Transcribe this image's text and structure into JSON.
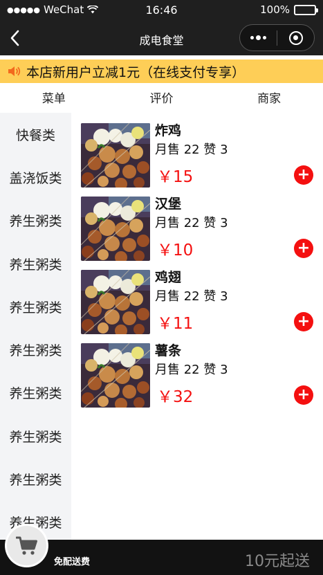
{
  "status": {
    "carrier": "WeChat",
    "time": "16:46",
    "battery": "100%"
  },
  "nav": {
    "title": "成电食堂"
  },
  "notice": {
    "text": "本店新用户立减1元（在线支付专享）"
  },
  "tabs": [
    {
      "label": "菜单"
    },
    {
      "label": "评价"
    },
    {
      "label": "商家"
    }
  ],
  "categories": [
    {
      "label": "快餐类"
    },
    {
      "label": "盖浇饭类"
    },
    {
      "label": "养生粥类"
    },
    {
      "label": "养生粥类"
    },
    {
      "label": "养生粥类"
    },
    {
      "label": "养生粥类"
    },
    {
      "label": "养生粥类"
    },
    {
      "label": "养生粥类"
    },
    {
      "label": "养生粥类"
    },
    {
      "label": "养生粥类"
    }
  ],
  "foods": [
    {
      "name": "炸鸡",
      "meta": "月售 22 赞 3",
      "price": "￥15",
      "add": "+"
    },
    {
      "name": "汉堡",
      "meta": "月售 22 赞 3",
      "price": "￥10",
      "add": "+"
    },
    {
      "name": "鸡翅",
      "meta": "月售 22 赞 3",
      "price": "￥11",
      "add": "+"
    },
    {
      "name": "薯条",
      "meta": "月售 22 赞 3",
      "price": "￥32",
      "add": "+"
    }
  ],
  "cart": {
    "free_shipping": "免配送费",
    "min_order": "10元起送"
  },
  "colors": {
    "bar_dark": "#1f1f1f",
    "notice_bg": "#fece57",
    "price_red": "#f41010",
    "sidebar_bg": "#f3f4f6"
  }
}
